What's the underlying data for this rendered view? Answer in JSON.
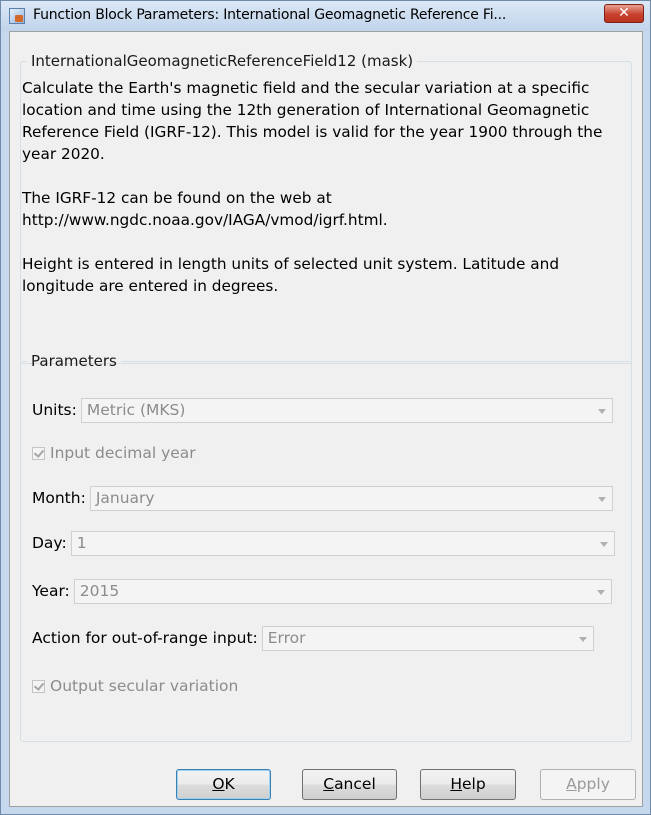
{
  "window": {
    "title": "Function Block Parameters: International Geomagnetic Reference Fi...",
    "close_glyph": "✕"
  },
  "description": {
    "legend": "InternationalGeomagneticReferenceField12 (mask)",
    "paragraphs": [
      "Calculate the Earth's magnetic field and the secular variation at a specific location and time using the 12th generation of International Geomagnetic Reference Field (IGRF-12).  This model is valid for the year 1900 through the year 2020.",
      "The IGRF-12 can be found on the web at http://www.ngdc.noaa.gov/IAGA/vmod/igrf.html.",
      "Height is entered in length units of selected unit system. Latitude and longitude are entered in degrees."
    ]
  },
  "parameters": {
    "legend": "Parameters",
    "units": {
      "label": "Units:",
      "value": "Metric (MKS)"
    },
    "input_decimal_year": {
      "label": "Input decimal year",
      "checked": true
    },
    "month": {
      "label": "Month:",
      "value": "January"
    },
    "day": {
      "label": "Day:",
      "value": "1"
    },
    "year": {
      "label": "Year:",
      "value": "2015"
    },
    "action": {
      "label": "Action for out-of-range input:",
      "value": "Error"
    },
    "output_secular_variation": {
      "label": "Output secular variation",
      "checked": true
    }
  },
  "buttons": {
    "ok": {
      "mnemonic": "O",
      "rest": "K"
    },
    "cancel": {
      "mnemonic": "C",
      "rest": "ancel"
    },
    "help": {
      "mnemonic": "H",
      "rest": "elp"
    },
    "apply": {
      "mnemonic": "A",
      "rest": "pply"
    }
  },
  "colors": {
    "titlebar": "#c5d8ee",
    "close_button": "#c7412e",
    "dialog_background": "#f0f0f0",
    "disabled_text": "#8c8c8c"
  }
}
